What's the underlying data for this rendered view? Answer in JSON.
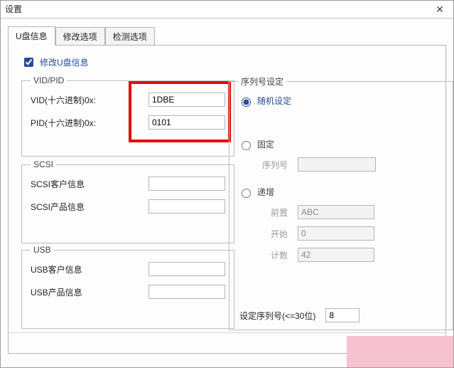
{
  "window": {
    "title": "设置"
  },
  "tabs": {
    "items": [
      {
        "label": "U盘信息",
        "active": true
      },
      {
        "label": "修改选项",
        "active": false
      },
      {
        "label": "检测选项",
        "active": false
      }
    ]
  },
  "modify_check": {
    "label": "修改U盘信息",
    "checked": true
  },
  "vidpid": {
    "legend": "VID/PID",
    "vid_label": "VID(十六进制)0x:",
    "vid_value": "1DBE",
    "pid_label": "PID(十六进制)0x:",
    "pid_value": "0101"
  },
  "scsi": {
    "legend": "SCSI",
    "cust_label": "SCSI客户信息",
    "cust_value": "",
    "prod_label": "SCSI产品信息",
    "prod_value": ""
  },
  "usb": {
    "legend": "USB",
    "cust_label": "USB客户信息",
    "cust_value": "",
    "prod_label": "USB产品信息",
    "prod_value": ""
  },
  "serial": {
    "legend": "序列号设定",
    "options": {
      "random": "随机设定",
      "fixed": "固定",
      "increment": "递增"
    },
    "selected": "random",
    "fixed_label": "序列号",
    "fixed_value": "",
    "inc_prefix_label": "前置",
    "inc_prefix_value": "ABC",
    "inc_start_label": "开始",
    "inc_start_value": "0",
    "inc_count_label": "计数",
    "inc_count_value": "42",
    "len_label": "设定序列号(<=30位)",
    "len_value": "8"
  }
}
